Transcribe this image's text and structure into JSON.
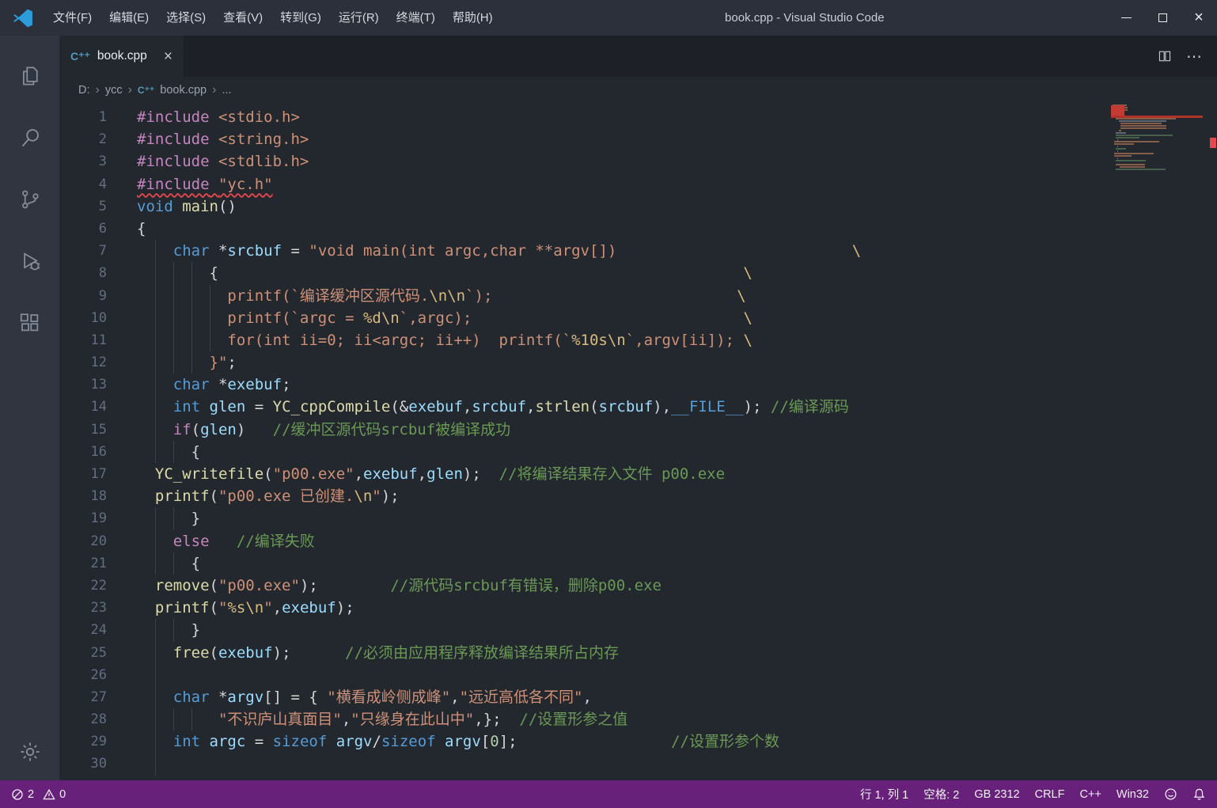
{
  "window": {
    "title": "book.cpp - Visual Studio Code"
  },
  "menus": [
    "文件(F)",
    "编辑(E)",
    "选择(S)",
    "查看(V)",
    "转到(G)",
    "运行(R)",
    "终端(T)",
    "帮助(H)"
  ],
  "activity_bar": {
    "items": [
      "explorer",
      "search",
      "source-control",
      "run-debug",
      "extensions"
    ],
    "bottom": [
      "settings"
    ]
  },
  "tab": {
    "label": "book.cpp",
    "close": "×"
  },
  "editor_actions": {
    "more": "⋯"
  },
  "breadcrumb": {
    "items": [
      "D:",
      "ycc",
      "book.cpp",
      "..."
    ],
    "file_icon_before": 2
  },
  "icons": {
    "logo": "vscode-logo",
    "cpp": "C⁺⁺",
    "chevron": "›",
    "error": "circle-slash",
    "warning": "triangle-exclamation",
    "feedback": "smiley",
    "bell": "bell",
    "split": "split-editor"
  },
  "editor": {
    "lines": [
      {
        "n": 1,
        "g": [],
        "t": [
          [
            "#include",
            "kc"
          ],
          [
            " ",
            "p"
          ],
          [
            "<stdio.h>",
            "s"
          ]
        ]
      },
      {
        "n": 2,
        "g": [],
        "t": [
          [
            "#include",
            "kc"
          ],
          [
            " ",
            "p"
          ],
          [
            "<string.h>",
            "s"
          ]
        ]
      },
      {
        "n": 3,
        "g": [],
        "t": [
          [
            "#include",
            "kc"
          ],
          [
            " ",
            "p"
          ],
          [
            "<stdlib.h>",
            "s"
          ]
        ]
      },
      {
        "n": 4,
        "g": [],
        "t": [
          [
            "#include",
            "kc err"
          ],
          [
            " ",
            "p err"
          ],
          [
            "\"yc.h\"",
            "s err"
          ]
        ]
      },
      {
        "n": 5,
        "g": [],
        "t": [
          [
            "void",
            "k"
          ],
          [
            " ",
            "p"
          ],
          [
            "main",
            "fn"
          ],
          [
            "()",
            "p"
          ]
        ]
      },
      {
        "n": 6,
        "g": [],
        "t": [
          [
            "{",
            "p"
          ]
        ]
      },
      {
        "n": 7,
        "g": [
          2
        ],
        "t": [
          [
            "    ",
            "p"
          ],
          [
            "char",
            "k"
          ],
          [
            " *",
            "p"
          ],
          [
            "srcbuf",
            "v"
          ],
          [
            " = ",
            "p"
          ],
          [
            "\"void main(int argc,char **argv[])",
            "s"
          ],
          [
            "                          ",
            "p"
          ],
          [
            "\\",
            "e"
          ]
        ]
      },
      {
        "n": 8,
        "g": [
          2,
          4,
          6
        ],
        "t": [
          [
            "        {",
            "p"
          ],
          [
            "                                                          ",
            "p"
          ],
          [
            "\\",
            "e"
          ]
        ]
      },
      {
        "n": 9,
        "g": [
          2,
          4,
          6,
          8
        ],
        "t": [
          [
            "          ",
            "p"
          ],
          [
            "printf(`编译缓冲区源代码.",
            "s"
          ],
          [
            "\\n\\n",
            "e"
          ],
          [
            "`);",
            "s"
          ],
          [
            "                           ",
            "p"
          ],
          [
            "\\",
            "e"
          ]
        ]
      },
      {
        "n": 10,
        "g": [
          2,
          4,
          6,
          8
        ],
        "t": [
          [
            "          ",
            "p"
          ],
          [
            "printf(`argc = ",
            "s"
          ],
          [
            "%d\\n",
            "e"
          ],
          [
            "`,argc);",
            "s"
          ],
          [
            "                              ",
            "p"
          ],
          [
            "\\",
            "e"
          ]
        ]
      },
      {
        "n": 11,
        "g": [
          2,
          4,
          6,
          8
        ],
        "t": [
          [
            "          ",
            "p"
          ],
          [
            "for(int ii=0; ii<argc; ii++)  printf(`",
            "s"
          ],
          [
            "%10s\\n",
            "e"
          ],
          [
            "`,argv[ii]); ",
            "s"
          ],
          [
            "\\",
            "e"
          ]
        ]
      },
      {
        "n": 12,
        "g": [
          2,
          4,
          6
        ],
        "t": [
          [
            "        ",
            "p"
          ],
          [
            "}\"",
            "s"
          ],
          [
            ";",
            "p"
          ]
        ]
      },
      {
        "n": 13,
        "g": [
          2
        ],
        "t": [
          [
            "    ",
            "p"
          ],
          [
            "char",
            "k"
          ],
          [
            " *",
            "p"
          ],
          [
            "exebuf",
            "v"
          ],
          [
            ";",
            "p"
          ]
        ]
      },
      {
        "n": 14,
        "g": [
          2
        ],
        "t": [
          [
            "    ",
            "p"
          ],
          [
            "int",
            "k"
          ],
          [
            " ",
            "p"
          ],
          [
            "glen",
            "v"
          ],
          [
            " = ",
            "p"
          ],
          [
            "YC_cppCompile",
            "fn"
          ],
          [
            "(&",
            "p"
          ],
          [
            "exebuf",
            "v"
          ],
          [
            ",",
            "p"
          ],
          [
            "srcbuf",
            "v"
          ],
          [
            ",",
            "p"
          ],
          [
            "strlen",
            "fn"
          ],
          [
            "(",
            "p"
          ],
          [
            "srcbuf",
            "v"
          ],
          [
            "),",
            "p"
          ],
          [
            "__FILE__",
            "k"
          ],
          [
            "); ",
            "p"
          ],
          [
            "//编译源码",
            "c"
          ]
        ]
      },
      {
        "n": 15,
        "g": [
          2
        ],
        "t": [
          [
            "    ",
            "p"
          ],
          [
            "if",
            "kc"
          ],
          [
            "(",
            "p"
          ],
          [
            "glen",
            "v"
          ],
          [
            ")",
            "p"
          ],
          [
            "   ",
            "p"
          ],
          [
            "//缓冲区源代码srcbuf被编译成功",
            "c"
          ]
        ]
      },
      {
        "n": 16,
        "g": [
          2,
          4
        ],
        "t": [
          [
            "      {",
            "p"
          ]
        ]
      },
      {
        "n": 17,
        "g": [],
        "t": [
          [
            "  ",
            "p"
          ],
          [
            "YC_writefile",
            "fn"
          ],
          [
            "(",
            "p"
          ],
          [
            "\"p00.exe\"",
            "s"
          ],
          [
            ",",
            "p"
          ],
          [
            "exebuf",
            "v"
          ],
          [
            ",",
            "p"
          ],
          [
            "glen",
            "v"
          ],
          [
            ");",
            "p"
          ],
          [
            "  ",
            "p"
          ],
          [
            "//将编译结果存入文件 p00.exe",
            "c"
          ]
        ]
      },
      {
        "n": 18,
        "g": [],
        "t": [
          [
            "  ",
            "p"
          ],
          [
            "printf",
            "fn"
          ],
          [
            "(",
            "p"
          ],
          [
            "\"p00.exe 已创建.",
            "s"
          ],
          [
            "\\n",
            "e"
          ],
          [
            "\"",
            "s"
          ],
          [
            ");",
            "p"
          ]
        ]
      },
      {
        "n": 19,
        "g": [
          2,
          4
        ],
        "t": [
          [
            "      }",
            "p"
          ]
        ]
      },
      {
        "n": 20,
        "g": [
          2
        ],
        "t": [
          [
            "    ",
            "p"
          ],
          [
            "else",
            "kc"
          ],
          [
            "   ",
            "p"
          ],
          [
            "//编译失败",
            "c"
          ]
        ]
      },
      {
        "n": 21,
        "g": [
          2,
          4
        ],
        "t": [
          [
            "      {",
            "p"
          ]
        ]
      },
      {
        "n": 22,
        "g": [],
        "t": [
          [
            "  ",
            "p"
          ],
          [
            "remove",
            "fn"
          ],
          [
            "(",
            "p"
          ],
          [
            "\"p00.exe\"",
            "s"
          ],
          [
            ");",
            "p"
          ],
          [
            "        ",
            "p"
          ],
          [
            "//源代码srcbuf有错误，删除p00.exe",
            "c"
          ]
        ]
      },
      {
        "n": 23,
        "g": [],
        "t": [
          [
            "  ",
            "p"
          ],
          [
            "printf",
            "fn"
          ],
          [
            "(",
            "p"
          ],
          [
            "\"",
            "s"
          ],
          [
            "%s\\n",
            "e"
          ],
          [
            "\"",
            "s"
          ],
          [
            ",",
            "p"
          ],
          [
            "exebuf",
            "v"
          ],
          [
            ");",
            "p"
          ]
        ]
      },
      {
        "n": 24,
        "g": [
          2,
          4
        ],
        "t": [
          [
            "      }",
            "p"
          ]
        ]
      },
      {
        "n": 25,
        "g": [
          2
        ],
        "t": [
          [
            "    ",
            "p"
          ],
          [
            "free",
            "fn"
          ],
          [
            "(",
            "p"
          ],
          [
            "exebuf",
            "v"
          ],
          [
            ");",
            "p"
          ],
          [
            "      ",
            "p"
          ],
          [
            "//必须由应用程序释放编译结果所占内存",
            "c"
          ]
        ]
      },
      {
        "n": 26,
        "g": [
          2
        ],
        "t": []
      },
      {
        "n": 27,
        "g": [
          2
        ],
        "t": [
          [
            "    ",
            "p"
          ],
          [
            "char",
            "k"
          ],
          [
            " *",
            "p"
          ],
          [
            "argv",
            "v"
          ],
          [
            "[] = { ",
            "p"
          ],
          [
            "\"横看成岭侧成峰\"",
            "s"
          ],
          [
            ",",
            "p"
          ],
          [
            "\"远近高低各不同\"",
            "s"
          ],
          [
            ",",
            "p"
          ]
        ]
      },
      {
        "n": 28,
        "g": [
          2,
          4,
          6
        ],
        "t": [
          [
            "         ",
            "p"
          ],
          [
            "\"不识庐山真面目\"",
            "s"
          ],
          [
            ",",
            "p"
          ],
          [
            "\"只缘身在此山中\"",
            "s"
          ],
          [
            ",};",
            "p"
          ],
          [
            "  ",
            "p"
          ],
          [
            "//设置形参之值",
            "c"
          ]
        ]
      },
      {
        "n": 29,
        "g": [
          2
        ],
        "t": [
          [
            "    ",
            "p"
          ],
          [
            "int",
            "k"
          ],
          [
            " ",
            "p"
          ],
          [
            "argc",
            "v"
          ],
          [
            " = ",
            "p"
          ],
          [
            "sizeof",
            "k"
          ],
          [
            " ",
            "p"
          ],
          [
            "argv",
            "v"
          ],
          [
            "/",
            "p"
          ],
          [
            "sizeof",
            "k"
          ],
          [
            " ",
            "p"
          ],
          [
            "argv",
            "v"
          ],
          [
            "[",
            "p"
          ],
          [
            "0",
            "n"
          ],
          [
            "];",
            "p"
          ],
          [
            "                 ",
            "p"
          ],
          [
            "//设置形参个数",
            "c"
          ]
        ]
      },
      {
        "n": 30,
        "g": [
          2
        ],
        "t": []
      }
    ]
  },
  "status_bar": {
    "errors": "2",
    "warnings": "0",
    "cursor": "行 1, 列 1",
    "indent": "空格: 2",
    "encoding": "GB 2312",
    "eol": "CRLF",
    "language": "C++",
    "platform": "Win32"
  },
  "colors": {
    "statusbar": "#68217A",
    "titlebar": "#2B303A",
    "activitybar": "#30353F",
    "editor_bg": "#23272E",
    "tabstrip": "#1D2127",
    "error": "#E5484D",
    "keyword": "#569CD6",
    "control": "#C586C0",
    "string": "#CE9178",
    "escape": "#D7BA7D",
    "comment": "#6A9955",
    "function": "#DCDCAA",
    "variable": "#9CDCFE",
    "number": "#B5CEA8",
    "cpp_icon": "#519ABA"
  }
}
